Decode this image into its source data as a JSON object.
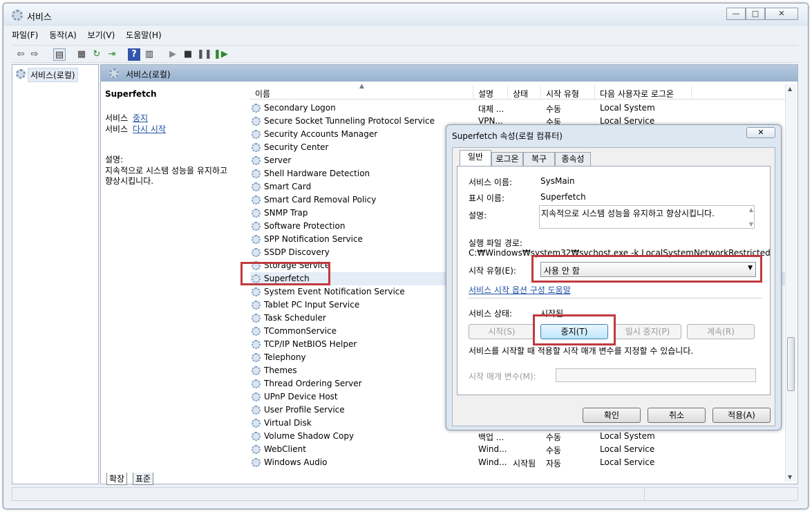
{
  "window": {
    "title": "서비스",
    "min": "—",
    "max": "□",
    "close": "✕"
  },
  "menu": [
    "파일(F)",
    "동작(A)",
    "보기(V)",
    "도움말(H)"
  ],
  "tree": {
    "root": "서비스(로컬)"
  },
  "pane": {
    "header": "서비스(로컬)",
    "selected_name": "Superfetch",
    "action_prefix": "서비스",
    "action_stop": "중지",
    "action_restart": "다시 시작",
    "desc_label": "설명:",
    "desc_text1": "지속적으로 시스템 성능을 유지하고",
    "desc_text2": "향상시킵니다."
  },
  "columns": {
    "name": "이름",
    "desc": "설명",
    "status": "상태",
    "startup": "시작 유형",
    "logon": "다음 사용자로 로그온"
  },
  "rows": [
    {
      "name": "Secondary Logon",
      "desc": "대체 ...",
      "status": "",
      "startup": "수동",
      "logon": "Local System"
    },
    {
      "name": "Secure Socket Tunneling Protocol Service",
      "desc": "VPN...",
      "status": "",
      "startup": "수동",
      "logon": "Local Service"
    },
    {
      "name": "Security Accounts Manager"
    },
    {
      "name": "Security Center"
    },
    {
      "name": "Server"
    },
    {
      "name": "Shell Hardware Detection"
    },
    {
      "name": "Smart Card"
    },
    {
      "name": "Smart Card Removal Policy"
    },
    {
      "name": "SNMP Trap"
    },
    {
      "name": "Software Protection"
    },
    {
      "name": "SPP Notification Service"
    },
    {
      "name": "SSDP Discovery"
    },
    {
      "name": "Storage Service"
    },
    {
      "name": "Superfetch"
    },
    {
      "name": "System Event Notification Service"
    },
    {
      "name": "Tablet PC Input Service"
    },
    {
      "name": "Task Scheduler"
    },
    {
      "name": "TCommonService"
    },
    {
      "name": "TCP/IP NetBIOS Helper"
    },
    {
      "name": "Telephony"
    },
    {
      "name": "Themes"
    },
    {
      "name": "Thread Ordering Server"
    },
    {
      "name": "UPnP Device Host"
    },
    {
      "name": "User Profile Service"
    },
    {
      "name": "Virtual Disk"
    },
    {
      "name": "Volume Shadow Copy",
      "desc": "백업 ...",
      "status": "",
      "startup": "수동",
      "logon": "Local System"
    },
    {
      "name": "WebClient",
      "desc": "Wind...",
      "status": "",
      "startup": "수동",
      "logon": "Local Service"
    },
    {
      "name": "Windows Audio",
      "desc": "Wind...",
      "status": "시작됨",
      "startup": "자동",
      "logon": "Local Service"
    }
  ],
  "bottom_tabs": [
    "확장",
    "표준"
  ],
  "dialog": {
    "title": "Superfetch 속성(로컬 컴퓨터)",
    "close": "✕",
    "tabs": [
      "일반",
      "로그온",
      "복구",
      "종속성"
    ],
    "service_name_label": "서비스 이름:",
    "service_name": "SysMain",
    "display_name_label": "표시 이름:",
    "display_name": "Superfetch",
    "desc_label": "설명:",
    "desc": "지속적으로 시스템 성능을 유지하고 향상시킵니다.",
    "path_label": "실행 파일 경로:",
    "path": "C:₩Windows₩system32₩svchost.exe -k LocalSystemNetworkRestricted",
    "startup_label": "시작 유형(E):",
    "startup_value": "사용 안 함",
    "help_link": "서비스 시작 옵션 구성 도움말",
    "status_label": "서비스 상태:",
    "status_value": "시작됨",
    "btn_start": "시작(S)",
    "btn_stop": "중지(T)",
    "btn_pause": "일시 중지(P)",
    "btn_resume": "계속(R)",
    "param_hint": "서비스를 시작할 때 적용할 시작 매개 변수를 지정할 수 있습니다.",
    "param_label": "시작 매개 변수(M):",
    "ok": "확인",
    "cancel": "취소",
    "apply": "적용(A)"
  }
}
